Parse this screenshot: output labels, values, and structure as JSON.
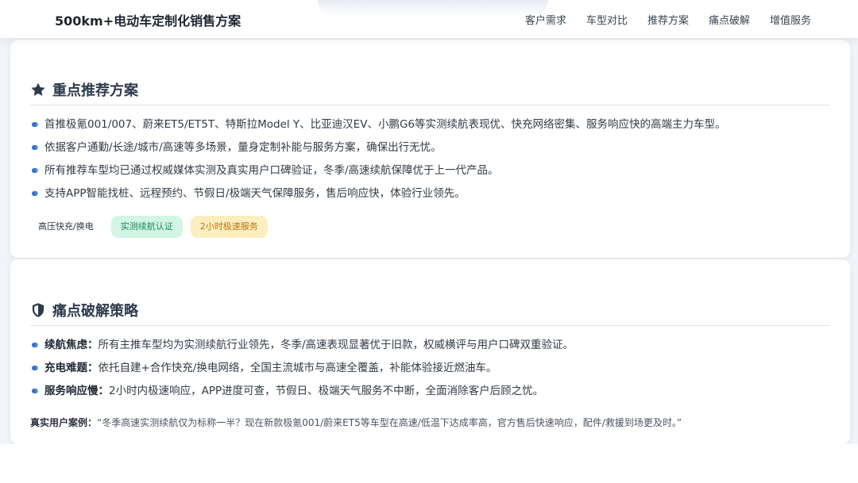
{
  "header": {
    "brand": "500km+电动车定制化销售方案",
    "nav": [
      "客户需求",
      "车型对比",
      "推荐方案",
      "痛点破解",
      "增值服务"
    ]
  },
  "recommend": {
    "title": "重点推荐方案",
    "icon": "star-icon",
    "bullets": [
      "首推极氪001/007、蔚来ET5/ET5T、特斯拉Model Y、比亚迪汉EV、小鹏G6等实测续航表现优、快充网络密集、服务响应快的高端主力车型。",
      "依据客户通勤/长途/城市/高速等多场景，量身定制补能与服务方案，确保出行无忧。",
      "所有推荐车型均已通过权威媒体实测及真实用户口碑验证，冬季/高速续航保障优于上一代产品。",
      "支持APP智能找桩、远程预约、节假日/极端天气保障服务，售后响应快，体验行业领先。"
    ],
    "tags": [
      "高压快充/换电",
      "实测续航认证",
      "2小时极速服务"
    ]
  },
  "painpoints": {
    "title": "痛点破解策略",
    "icon": "shield-icon",
    "items": [
      {
        "label": "续航焦虑：",
        "text": "所有主推车型均为实测续航行业领先，冬季/高速表现显著优于旧款，权威横评与用户口碑双重验证。"
      },
      {
        "label": "充电难题：",
        "text": "依托自建+合作快充/换电网络，全国主流城市与高速全覆盖，补能体验接近燃油车。"
      },
      {
        "label": "服务响应慢：",
        "text": "2小时内极速响应，APP进度可查，节假日、极端天气服务不中断，全面消除客户后顾之忧。"
      }
    ],
    "case_label": "真实用户案例：",
    "case_text": "“冬季高速实测续航仅为标称一半？现在新款极氪001/蔚来ET5等车型在高速/低温下达成率高，官方售后快速响应，配件/救援到场更及时。”"
  },
  "colors": {
    "accent": "#2d6fcc",
    "title": "#2c3a4c",
    "tag_green_bg": "#d2f5e4",
    "tag_green_text": "#1d8a55",
    "tag_yellow_bg": "#fdeec0",
    "tag_yellow_text": "#b8750f"
  }
}
